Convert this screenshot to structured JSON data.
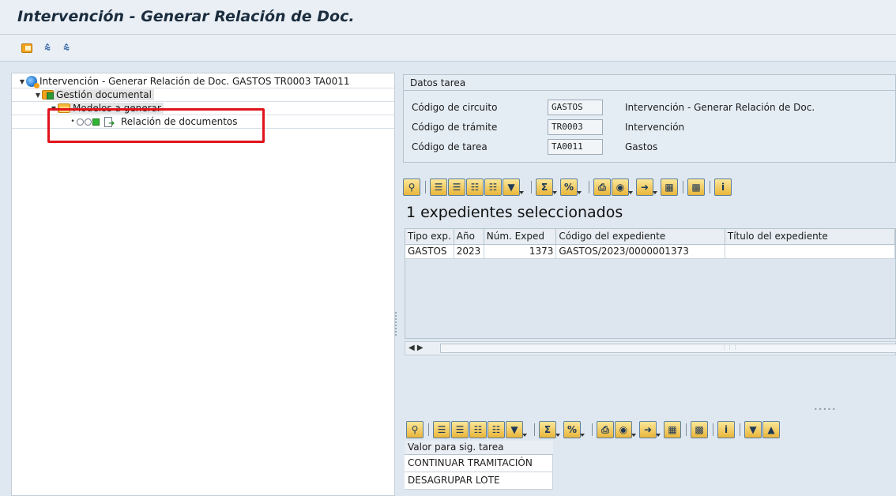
{
  "window": {
    "title": "Intervención - Generar Relación de Doc."
  },
  "toolbar": {
    "icons": [
      "folder-icon",
      "expand-all-icon",
      "collapse-all-icon"
    ]
  },
  "tree": {
    "root": "Intervención - Generar Relación de Doc. GASTOS TR0003 TA0011",
    "level1": "Gestión documental",
    "level2": "Modelos a generar",
    "level3": "Relación de documentos"
  },
  "datos_tarea": {
    "header": "Datos tarea",
    "rows": [
      {
        "label": "Código de circuito",
        "value": "GASTOS",
        "desc": "Intervención - Generar Relación de Doc."
      },
      {
        "label": "Código de trámite",
        "value": "TR0003",
        "desc": "Intervención"
      },
      {
        "label": "Código de tarea",
        "value": "TA0011",
        "desc": "Gastos"
      }
    ]
  },
  "expedientes": {
    "title": "1 expedientes seleccionados",
    "columns": [
      "Tipo exp.",
      "Año",
      "Núm. Exped",
      "Código del expediente",
      "Título del expediente"
    ],
    "rows": [
      {
        "tipo": "GASTOS",
        "anio": "2023",
        "num": "1373",
        "codigo": "GASTOS/2023/0000001373",
        "titulo": ""
      }
    ]
  },
  "siguiente_tarea": {
    "header": "Valor para sig. tarea",
    "values": [
      "CONTINUAR TRAMITACIÓN",
      "DESAGRUPAR LOTE"
    ]
  },
  "colors": {
    "highlight": "#e0141b",
    "background": "#dfe8f0"
  }
}
